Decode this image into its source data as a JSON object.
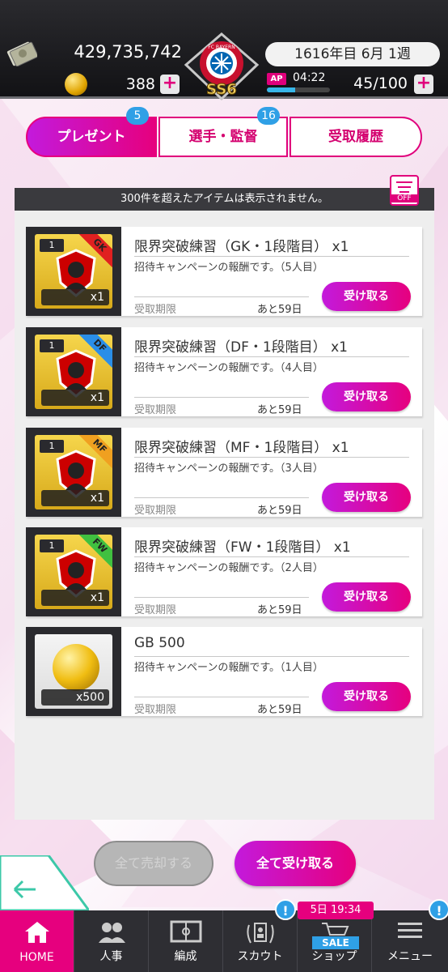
{
  "header": {
    "money": "429,735,742",
    "gb": "388",
    "club_logo_text": "FC BAYERN MÜNCHEN",
    "game_logo": "SS6",
    "date": "1616年目 6月 1週",
    "ap_label": "AP",
    "ap_timer": "04:22",
    "ap_value": "45/100",
    "ap_fill": 0.45,
    "plus": "+"
  },
  "tabs": [
    {
      "label": "プレゼント",
      "count": "5",
      "active": true
    },
    {
      "label": "選手・監督",
      "count": "16",
      "active": false
    },
    {
      "label": "受取履歴",
      "count": "",
      "active": false
    }
  ],
  "notice": "300件を超えたアイテムは表示されません。",
  "filter": {
    "icon": "filter-icon",
    "label": "OFF"
  },
  "items": [
    {
      "title": "限界突破練習（GK・1段階目） x1",
      "pos": "GK",
      "pos_color": "#e02020",
      "rank": "1",
      "qty": "x1",
      "desc": "招待キャンペーンの報酬です。（5人目）",
      "limit_label": "受取期限",
      "limit": "あと59日",
      "button": "受け取る"
    },
    {
      "title": "限界突破練習（DF・1段階目） x1",
      "pos": "DF",
      "pos_color": "#2a8ee8",
      "rank": "1",
      "qty": "x1",
      "desc": "招待キャンペーンの報酬です。（4人目）",
      "limit_label": "受取期限",
      "limit": "あと59日",
      "button": "受け取る"
    },
    {
      "title": "限界突破練習（MF・1段階目） x1",
      "pos": "MF",
      "pos_color": "#f0a020",
      "rank": "1",
      "qty": "x1",
      "desc": "招待キャンペーンの報酬です。（3人目）",
      "limit_label": "受取期限",
      "limit": "あと59日",
      "button": "受け取る"
    },
    {
      "title": "限界突破練習（FW・1段階目） x1",
      "pos": "FW",
      "pos_color": "#40c040",
      "rank": "1",
      "qty": "x1",
      "desc": "招待キャンペーンの報酬です。（2人目）",
      "limit_label": "受取期限",
      "limit": "あと59日",
      "button": "受け取る"
    },
    {
      "title": "GB 500",
      "pos": "",
      "pos_color": "",
      "rank": "",
      "qty": "x500",
      "desc": "招待キャンペーンの報酬です。（1人目）",
      "limit_label": "受取期限",
      "limit": "あと59日",
      "button": "受け取る"
    }
  ],
  "bottom": {
    "sell_all": "全て売却する",
    "receive_all": "全て受け取る"
  },
  "nav": {
    "home": "HOME",
    "hr": "人事",
    "lineup": "編成",
    "scout": "スカウト",
    "shop": "ショップ",
    "menu": "メニュー",
    "shop_timer": "5日 19:34",
    "sale": "SALE",
    "alert": "!"
  }
}
